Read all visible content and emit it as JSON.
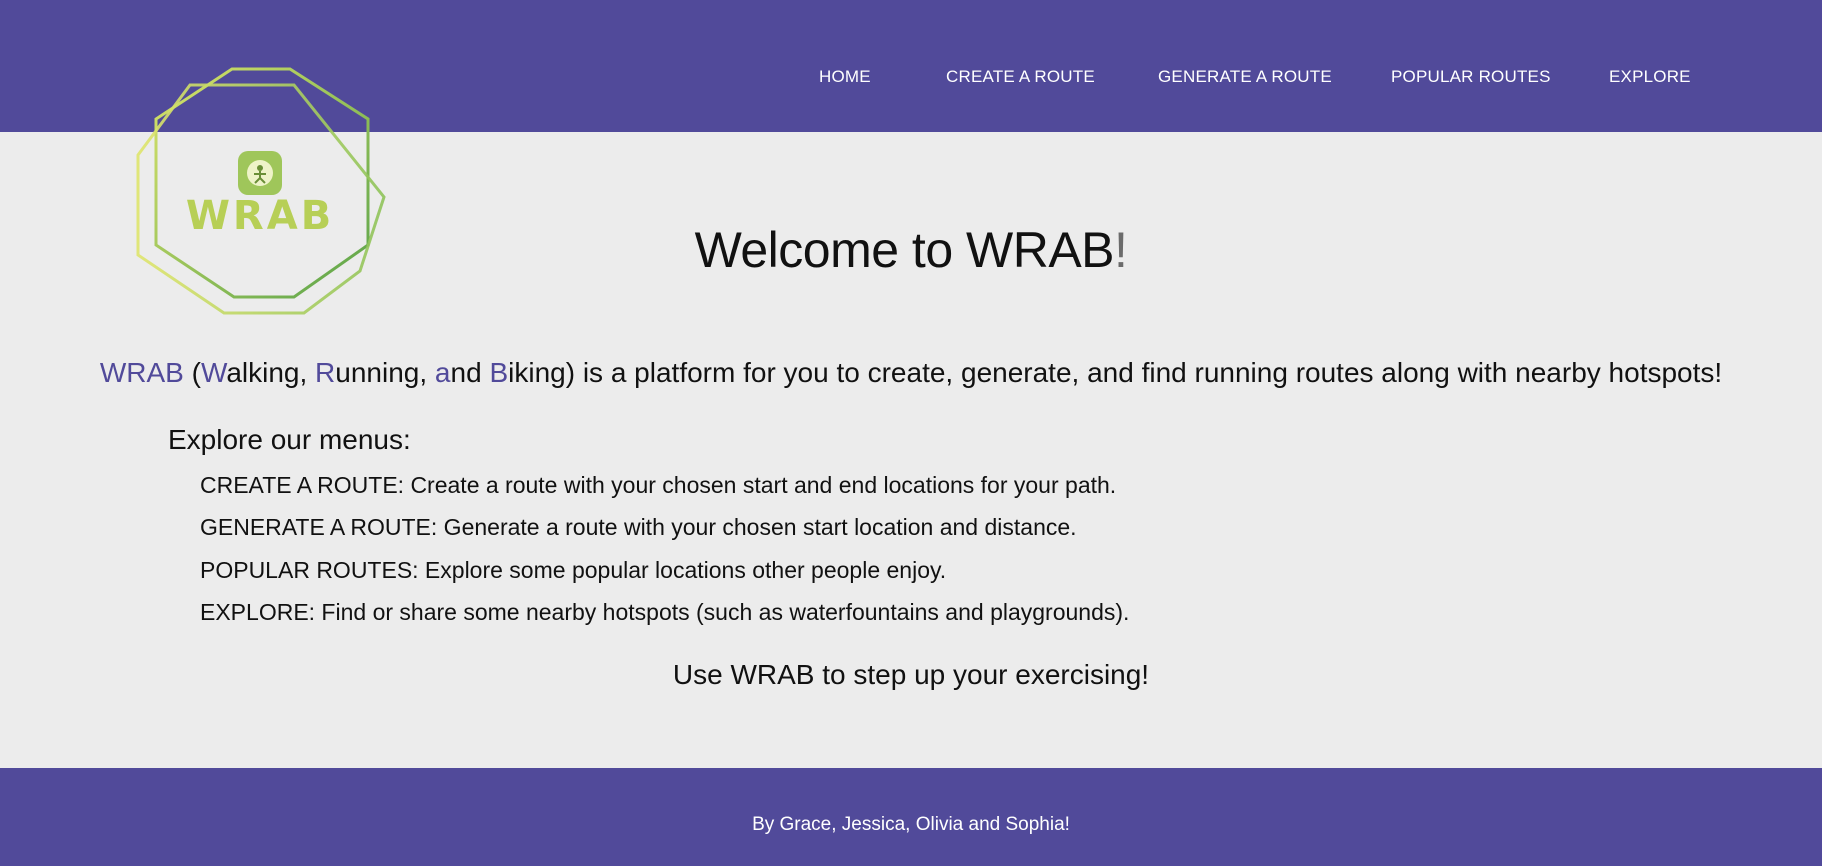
{
  "colors": {
    "brand_purple": "#514a9a",
    "background": "#ececec",
    "logo_green_light": "#d9e36a",
    "logo_green_dark": "#5aa34a"
  },
  "nav": {
    "items": [
      {
        "label": "HOME"
      },
      {
        "label": "CREATE A ROUTE"
      },
      {
        "label": "GENERATE A ROUTE"
      },
      {
        "label": "POPULAR ROUTES"
      },
      {
        "label": "EXPLORE"
      }
    ]
  },
  "logo": {
    "text": "WRAB",
    "icon": "runner-icon"
  },
  "main": {
    "title": "Welcome to WRAB",
    "title_suffix": "!",
    "intro": {
      "brand": "WRAB",
      "open_paren": " (",
      "w": "W",
      "w_rest": "alking, ",
      "r": "R",
      "r_rest": "unning, ",
      "a": "a",
      "a_rest": "nd ",
      "b": "B",
      "b_rest": "iking)",
      "tail": " is a platform for you to create, generate, and find running routes along with nearby hotspots!"
    },
    "menus_heading": "Explore our menus:",
    "menu_descriptions": [
      "CREATE A ROUTE: Create a route with your chosen start and end locations for your path.",
      "GENERATE A ROUTE: Generate a route with your chosen start location and distance.",
      "POPULAR ROUTES: Explore some popular locations other people enjoy.",
      "EXPLORE: Find or share some nearby hotspots (such as waterfountains and playgrounds)."
    ],
    "cta": "Use WRAB to step up your exercising!"
  },
  "footer": {
    "text": "By Grace, Jessica, Olivia and Sophia!"
  }
}
